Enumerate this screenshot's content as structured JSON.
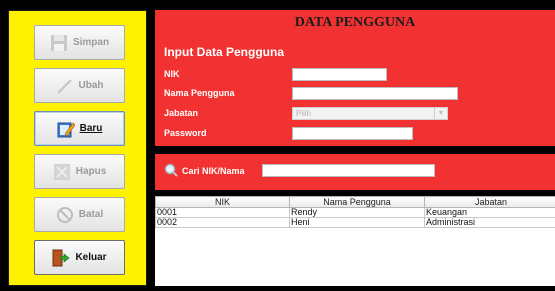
{
  "sidebar": {
    "buttons": [
      {
        "label": "Simpan",
        "enabled": false
      },
      {
        "label": "Ubah",
        "enabled": false
      },
      {
        "label": "Baru",
        "enabled": true
      },
      {
        "label": "Hapus",
        "enabled": false
      },
      {
        "label": "Batal",
        "enabled": false
      },
      {
        "label": "Keluar",
        "enabled": true
      }
    ]
  },
  "form": {
    "title": "DATA PENGGUNA",
    "section": "Input Data Pengguna",
    "nik_label": "NIK",
    "nama_label": "Nama Pengguna",
    "jabatan_label": "Jabatan",
    "password_label": "Password",
    "jabatan_selected": "Pilih"
  },
  "search": {
    "label": "Cari NIK/Nama"
  },
  "table": {
    "columns": [
      "NIK",
      "Nama Pengguna",
      "Jabatan"
    ],
    "rows": [
      [
        "0001",
        "Rendy",
        "Keuangan"
      ],
      [
        "0002",
        "Heni",
        "Administrasi"
      ]
    ]
  },
  "colors": {
    "sidebar_bg": "#fef200",
    "panel_bg": "#f23232",
    "window_bg": "#000000"
  }
}
